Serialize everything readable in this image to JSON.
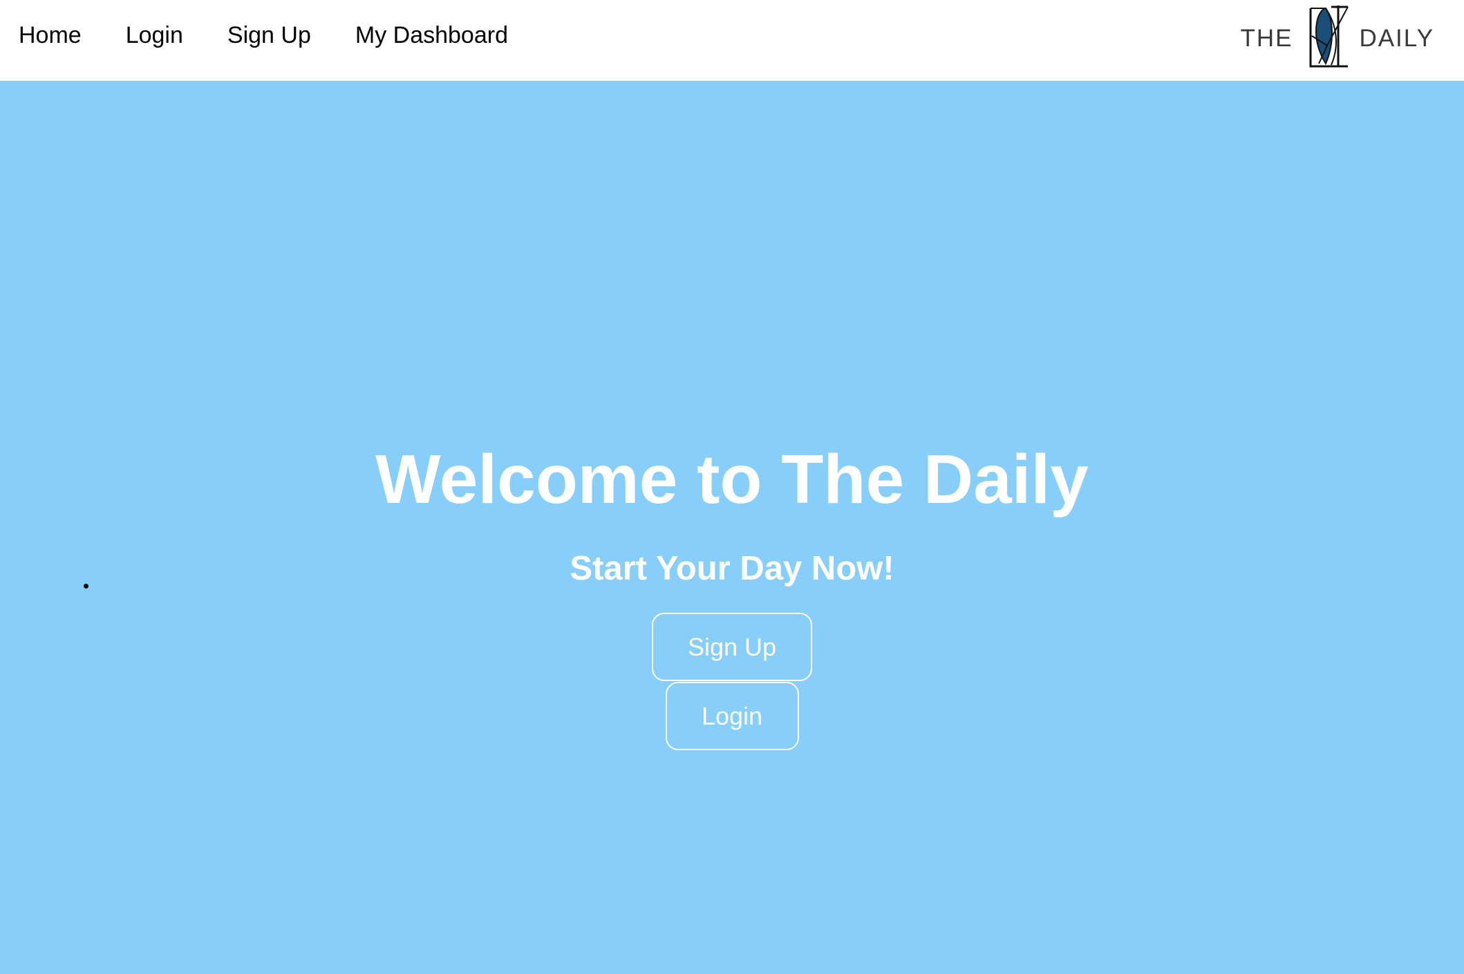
{
  "nav": {
    "items": [
      {
        "label": "Home"
      },
      {
        "label": "Login"
      },
      {
        "label": "Sign Up"
      },
      {
        "label": "My Dashboard"
      }
    ]
  },
  "logo": {
    "left_text": "THE",
    "right_text": "DAILY",
    "icon": "the-daily-monogram-icon",
    "accent_color": "#1b4f7a"
  },
  "hero": {
    "background_color": "#87cefa",
    "title": "Welcome to The Daily",
    "subtitle": "Start Your Day Now!",
    "signup_label": "Sign Up",
    "login_label": "Login"
  }
}
